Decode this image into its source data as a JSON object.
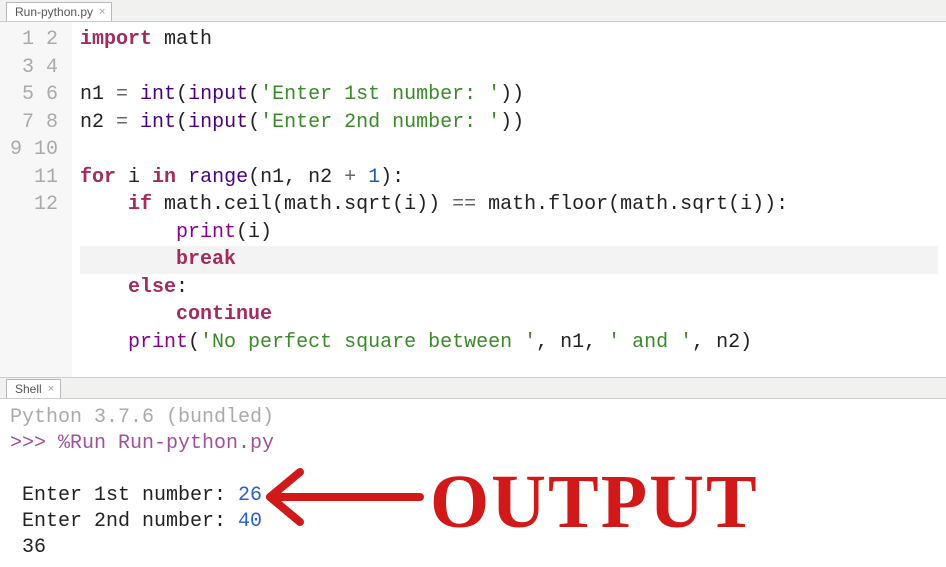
{
  "tabs": {
    "editor": "Run-python.py",
    "shell": "Shell"
  },
  "code": {
    "ln": [
      "1",
      "2",
      "3",
      "4",
      "5",
      "6",
      "7",
      "8",
      "9",
      "10",
      "11",
      "12"
    ],
    "l1_import": "import",
    "l1_math": " math",
    "l3_n1": "n1 ",
    "l3_eq": "= ",
    "l3_int": "int",
    "l3_p1": "(",
    "l3_input": "input",
    "l3_p2": "(",
    "l3_str": "'Enter 1st number: '",
    "l3_p3": "))",
    "l4_n2": "n2 ",
    "l4_eq": "= ",
    "l4_int": "int",
    "l4_p1": "(",
    "l4_input": "input",
    "l4_p2": "(",
    "l4_str": "'Enter 2nd number: '",
    "l4_p3": "))",
    "l6_for": "for",
    "l6_a": " i ",
    "l6_in": "in",
    "l6_b": " ",
    "l6_range": "range",
    "l6_c": "(n1, n2 ",
    "l6_op": "+",
    "l6_d": " ",
    "l6_num": "1",
    "l6_e": "):",
    "l7_a": "    ",
    "l7_if": "if",
    "l7_b": " math.ceil(math.sqrt(i)) ",
    "l7_op": "==",
    "l7_c": " math.floor(math.sqrt(i)):",
    "l8_a": "        ",
    "l8_print": "print",
    "l8_b": "(i)",
    "l9_a": "        ",
    "l9_break": "break",
    "l10_a": "    ",
    "l10_else": "else",
    "l10_b": ":",
    "l11_a": "        ",
    "l11_cont": "continue",
    "l12_a": "    ",
    "l12_print": "print",
    "l12_b": "(",
    "l12_s1": "'No perfect square between '",
    "l12_c": ", n1, ",
    "l12_s2": "' and '",
    "l12_d": ", n2)"
  },
  "shell": {
    "banner": "Python 3.7.6 (bundled)",
    "prompt": ">>> ",
    "run": "%Run Run-python.py",
    "p1": " Enter 1st number: ",
    "v1": "26",
    "p2": " Enter 2nd number: ",
    "v2": "40",
    "out": " 36"
  },
  "annotation": "OUTPUT"
}
